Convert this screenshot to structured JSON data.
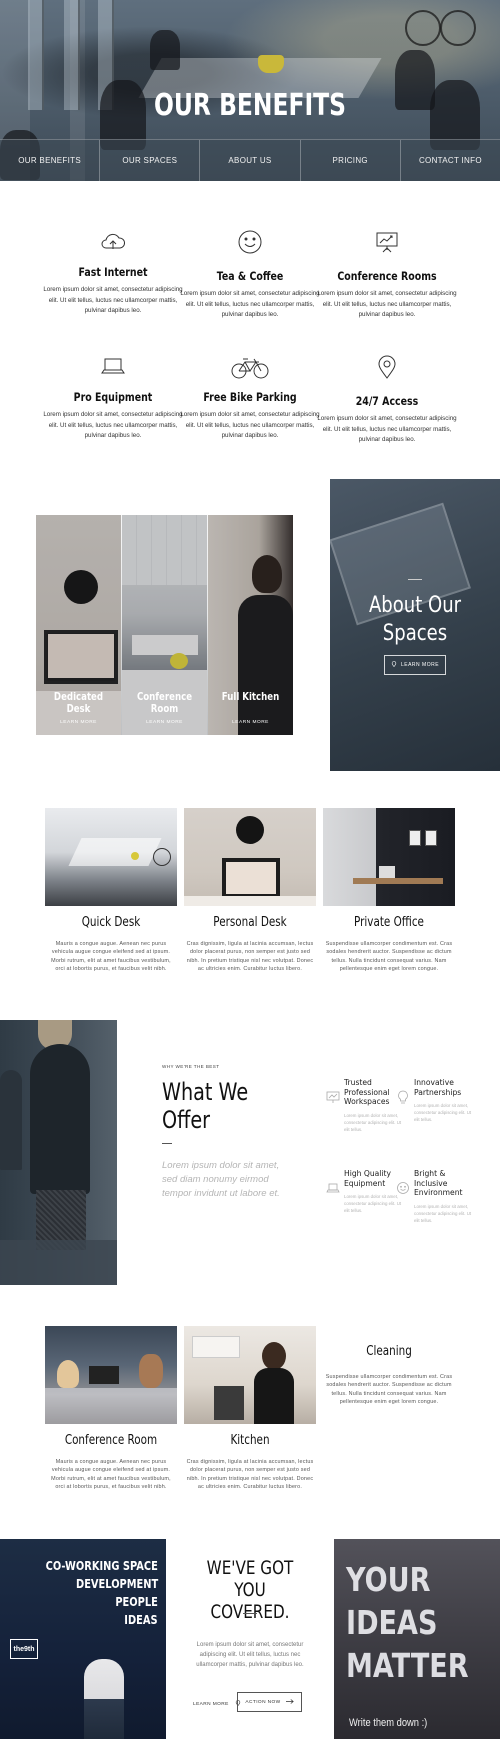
{
  "hero": {
    "title": "OUR BENEFITS",
    "nav": [
      "OUR BENEFITS",
      "OUR SPACES",
      "ABOUT US",
      "PRICING",
      "CONTACT INFO"
    ]
  },
  "benefits": [
    {
      "icon": "cloud-upload-icon",
      "title": "Fast Internet",
      "desc": "Lorem ipsum dolor sit amet, consectetur adipiscing elit. Ut elit tellus, luctus nec ullamcorper mattis, pulvinar dapibus leo."
    },
    {
      "icon": "smiley-icon",
      "title": "Tea & Coffee",
      "desc": "Lorem ipsum dolor sit amet, consectetur adipiscing elit. Ut elit tellus, luctus nec ullamcorper mattis, pulvinar dapibus leo."
    },
    {
      "icon": "presentation-board-icon",
      "title": "Conference Rooms",
      "desc": "Lorem ipsum dolor sit amet, consectetur adipiscing elit. Ut elit tellus, luctus nec ullamcorper mattis, pulvinar dapibus leo."
    },
    {
      "icon": "laptop-icon",
      "title": "Pro Equipment",
      "desc": "Lorem ipsum dolor sit amet, consectetur adipiscing elit. Ut elit tellus, luctus nec ullamcorper mattis, pulvinar dapibus leo."
    },
    {
      "icon": "bicycle-icon",
      "title": "Free Bike Parking",
      "desc": "Lorem ipsum dolor sit amet, consectetur adipiscing elit. Ut elit tellus, luctus nec ullamcorper mattis, pulvinar dapibus leo."
    },
    {
      "icon": "map-pin-icon",
      "title": "24/7 Access",
      "desc": "Lorem ipsum dolor sit amet, consectetur adipiscing elit. Ut elit tellus, luctus nec ullamcorper mattis, pulvinar dapibus leo."
    }
  ],
  "collage": [
    {
      "label": "Dedicated Desk",
      "link": "LEARN MORE"
    },
    {
      "label": "Conference Room",
      "link": "LEARN MORE"
    },
    {
      "label": "Full Kitchen",
      "link": "LEARN MORE"
    }
  ],
  "about": {
    "title_line1": "About Our",
    "title_line2": "Spaces",
    "button": "LEARN MORE"
  },
  "spaces": [
    {
      "name": "Quick Desk",
      "desc": "Mauris a congue augue. Aenean nec purus vehicula augue congue eleifend sed at ipsum. Morbi rutrum, elit at amet faucibus vestibulum, orci at lobortis purus, et faucibus velit nibh."
    },
    {
      "name": "Personal Desk",
      "desc": "Cras dignissim, ligula at lacinia accumsan, lectus dolor placerat purus, non semper est justo sed nibh. In pretium tristique nisl nec volutpat. Donec ac ultricies enim. Curabitur luctus libero."
    },
    {
      "name": "Private Office",
      "desc": "Suspendisse ullamcorper condimentum est. Cras sodales hendrerit auctor. Suspendisse ac dictum tellus. Nulla tincidunt consequat varius. Nam pellentesque enim eget lorem congue."
    }
  ],
  "offer": {
    "kicker": "WHY WE'RE THE BEST",
    "title_line1": "What We",
    "title_line2": "Offer",
    "quote": "Lorem ipsum dolor sit amet, sed diam nonumy eirmod tempor invidunt ut labore et.",
    "items": [
      {
        "icon": "presentation-chart-icon",
        "title": "Trusted Professional Workspaces",
        "desc": "Lorem ipsum dolor sit amet, consectetur adipiscing elit. Ut elit tellus."
      },
      {
        "icon": "lightbulb-icon",
        "title": "Innovative Partnerships",
        "desc": "Lorem ipsum dolor sit amet, consectetur adipiscing elit. Ut elit tellus."
      },
      {
        "icon": "laptop-icon",
        "title": "High Quality Equipment",
        "desc": "Lorem ipsum dolor sit amet, consectetur adipiscing elit. Ut elit tellus."
      },
      {
        "icon": "smiley-icon",
        "title": "Bright & Inclusive Environment",
        "desc": "Lorem ipsum dolor sit amet, consectetur adipiscing elit. Ut elit tellus."
      }
    ]
  },
  "amenities": [
    {
      "name": "Conference Room",
      "desc": "Mauris a congue augue. Aenean nec purus vehicula augue congue eleifend sed at ipsum. Morbi rutrum, elit at amet faucibus vestibulum, orci at lobortis purus, et faucibus velit nibh."
    },
    {
      "name": "Kitchen",
      "desc": "Cras dignissim, ligula at lacinia accumsan, lectus dolor placerat purus, non semper est justo sed nibh. In pretium tristique nisl nec volutpat. Donec ac ultricies enim. Curabitur luctus libero."
    },
    {
      "name": "Cleaning",
      "desc": "Suspendisse ullamcorper condimentum est. Cras sodales hendrerit auctor. Suspendisse ac dictum tellus. Nulla tincidunt consequat varius. Nam pellentesque enim eget lorem congue."
    }
  ],
  "footer": {
    "wall_lines": [
      "CO-WORKING SPACE",
      "DEVELOPMENT",
      "PEOPLE",
      "IDEAS"
    ],
    "wall_logo": "the9th",
    "title_line1": "WE'VE GOT YOU",
    "title_line2": "COVERED.",
    "desc": "Lorem ipsum dolor sit amet, consectetur adipiscing elit. Ut elit tellus, luctus nec ullamcorper mattis, pulvinar dapibus leo.",
    "learn_more": "LEARN MORE",
    "action": "ACTION NOW",
    "sign_lines": [
      "YOUR",
      "IDEAS",
      "MATTER"
    ],
    "sign_sub": "Write them down :)"
  }
}
